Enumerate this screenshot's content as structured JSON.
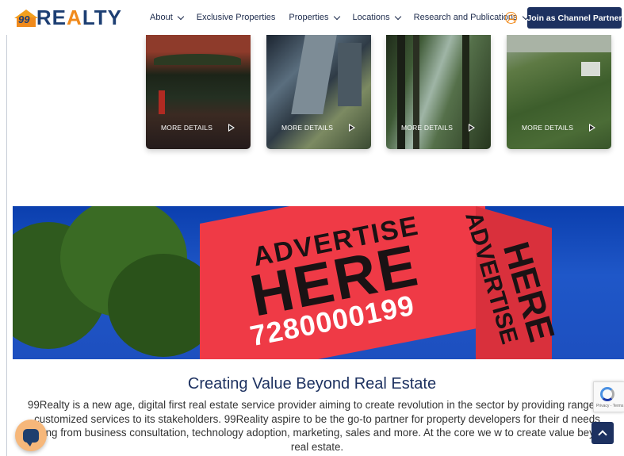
{
  "header": {
    "logo": {
      "badge_number": "99",
      "text_before": "RE",
      "text_accent": "A",
      "text_after": "LTY"
    },
    "nav": [
      {
        "label": "About",
        "has_dropdown": true
      },
      {
        "label": "Exclusive Properties",
        "has_dropdown": false
      },
      {
        "label": "Properties",
        "has_dropdown": true
      },
      {
        "label": "Locations",
        "has_dropdown": true
      },
      {
        "label": "Research and Publications",
        "has_dropdown": true
      }
    ],
    "user_icon": "user-circle-icon",
    "cta_label": "Join as Channel Partner"
  },
  "cards": [
    {
      "more_label": "MORE DETAILS",
      "icon": "play-icon"
    },
    {
      "more_label": "MORE DETAILS",
      "icon": "play-icon"
    },
    {
      "more_label": "MORE DETAILS",
      "icon": "play-icon"
    },
    {
      "more_label": "MORE DETAILS",
      "icon": "play-icon"
    }
  ],
  "banner": {
    "line1": "ADVERTISE",
    "line2": "HERE",
    "phone": "7280000199",
    "side_line1": "ADVERTISE",
    "side_line2": "HERE"
  },
  "about": {
    "title": "Creating Value Beyond Real Estate",
    "body": "99Realty is a new age, digital first real estate service provider aiming to create revolution in the sector by providing range of customized services to its stakeholders. 99Reality aspire to be the go-to partner for property developers for their d needs ranging from business consultation, technology adoption, marketing, sales and more. At the core we w to create value beyond real estate."
  },
  "widgets": {
    "recaptcha_text": "Privacy - Terms",
    "chat_icon": "chat-bubble-icon",
    "scroll_top_icon": "chevron-up-icon"
  },
  "colors": {
    "brand_navy": "#1d3160",
    "brand_orange": "#f08a1c",
    "banner_blue": "#1f57c8",
    "billboard_red": "#ef3a46"
  }
}
